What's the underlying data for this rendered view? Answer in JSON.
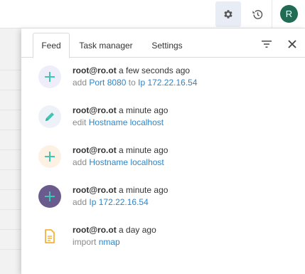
{
  "topbar": {
    "avatar_initial": "R"
  },
  "panel": {
    "tabs": [
      {
        "label": "Feed",
        "active": true
      },
      {
        "label": "Task manager",
        "active": false
      },
      {
        "label": "Settings",
        "active": false
      }
    ]
  },
  "feed": [
    {
      "user": "root@ro.ot",
      "time": "a few seconds ago",
      "icon": "plus-icon",
      "icon_bg": "#eeeefb",
      "icon_color": "#3fc6b4",
      "action": "add",
      "parts": [
        {
          "text": "Port 8080",
          "link": true
        },
        {
          "text": " to ",
          "link": false
        },
        {
          "text": "Ip 172.22.16.54",
          "link": true
        }
      ]
    },
    {
      "user": "root@ro.ot",
      "time": "a minute ago",
      "icon": "pencil-icon",
      "icon_bg": "#eef1f8",
      "icon_color": "#3fc6b4",
      "action": "edit",
      "parts": [
        {
          "text": "Hostname localhost",
          "link": true
        }
      ]
    },
    {
      "user": "root@ro.ot",
      "time": "a minute ago",
      "icon": "plus-icon",
      "icon_bg": "#fdf1e4",
      "icon_color": "#3fc6b4",
      "action": "add",
      "parts": [
        {
          "text": "Hostname localhost",
          "link": true
        }
      ]
    },
    {
      "user": "root@ro.ot",
      "time": "a minute ago",
      "icon": "plus-icon",
      "icon_bg": "#6a5b8e",
      "icon_color": "#3fc6b4",
      "action": "add",
      "parts": [
        {
          "text": "Ip 172.22.16.54",
          "link": true
        }
      ]
    },
    {
      "user": "root@ro.ot",
      "time": "a day ago",
      "icon": "document-icon",
      "icon_bg": "#ffffff",
      "icon_color": "#f2b33a",
      "action": "import",
      "parts": [
        {
          "text": "nmap",
          "link": true
        }
      ]
    }
  ],
  "colors": {
    "link": "#2f86c9",
    "avatar_bg": "#1f6b53",
    "panel_bg": "#ffffff"
  }
}
